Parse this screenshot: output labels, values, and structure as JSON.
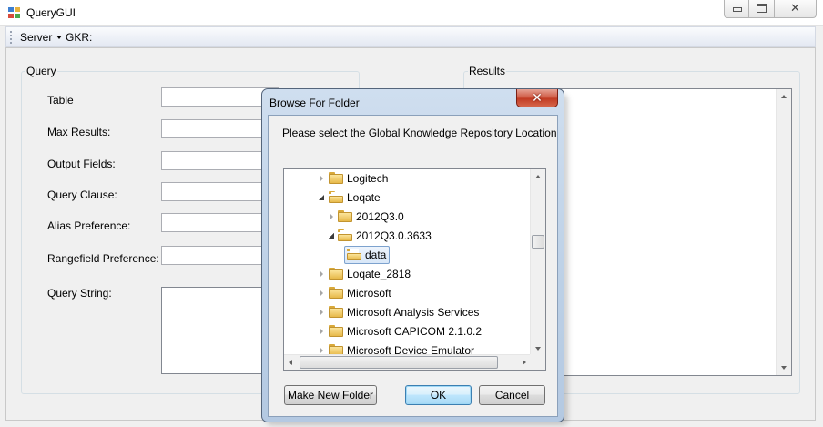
{
  "window": {
    "title": "QueryGUI"
  },
  "menu": {
    "server": "Server",
    "gkr": "GKR:"
  },
  "query": {
    "group_label": "Query",
    "fields": {
      "table": "Table",
      "max_results": "Max Results:",
      "output_fields": "Output Fields:",
      "query_clause": "Query Clause:",
      "alias_preference": "Alias Preference:",
      "rangefield_preference": "Rangefield Preference:",
      "query_string": "Query String:"
    }
  },
  "results": {
    "group_label": "Results"
  },
  "dialog": {
    "title": "Browse For Folder",
    "prompt": "Please select the Global Knowledge Repository Location",
    "tree": [
      {
        "label": "Logitech"
      },
      {
        "label": "Loqate"
      },
      {
        "label": "2012Q3.0"
      },
      {
        "label": "2012Q3.0.3633"
      },
      {
        "label": "data"
      },
      {
        "label": "Loqate_2818"
      },
      {
        "label": "Microsoft"
      },
      {
        "label": "Microsoft Analysis Services"
      },
      {
        "label": "Microsoft CAPICOM 2.1.0.2"
      },
      {
        "label": "Microsoft Device Emulator"
      }
    ],
    "buttons": {
      "make_new_folder": "Make New Folder",
      "ok": "OK",
      "cancel": "Cancel"
    }
  },
  "colors": {
    "dialog_frame": "#b9cde4",
    "selection_border": "#7da2ce",
    "close_button": "#c94b34",
    "folder": "#e7b94a"
  }
}
